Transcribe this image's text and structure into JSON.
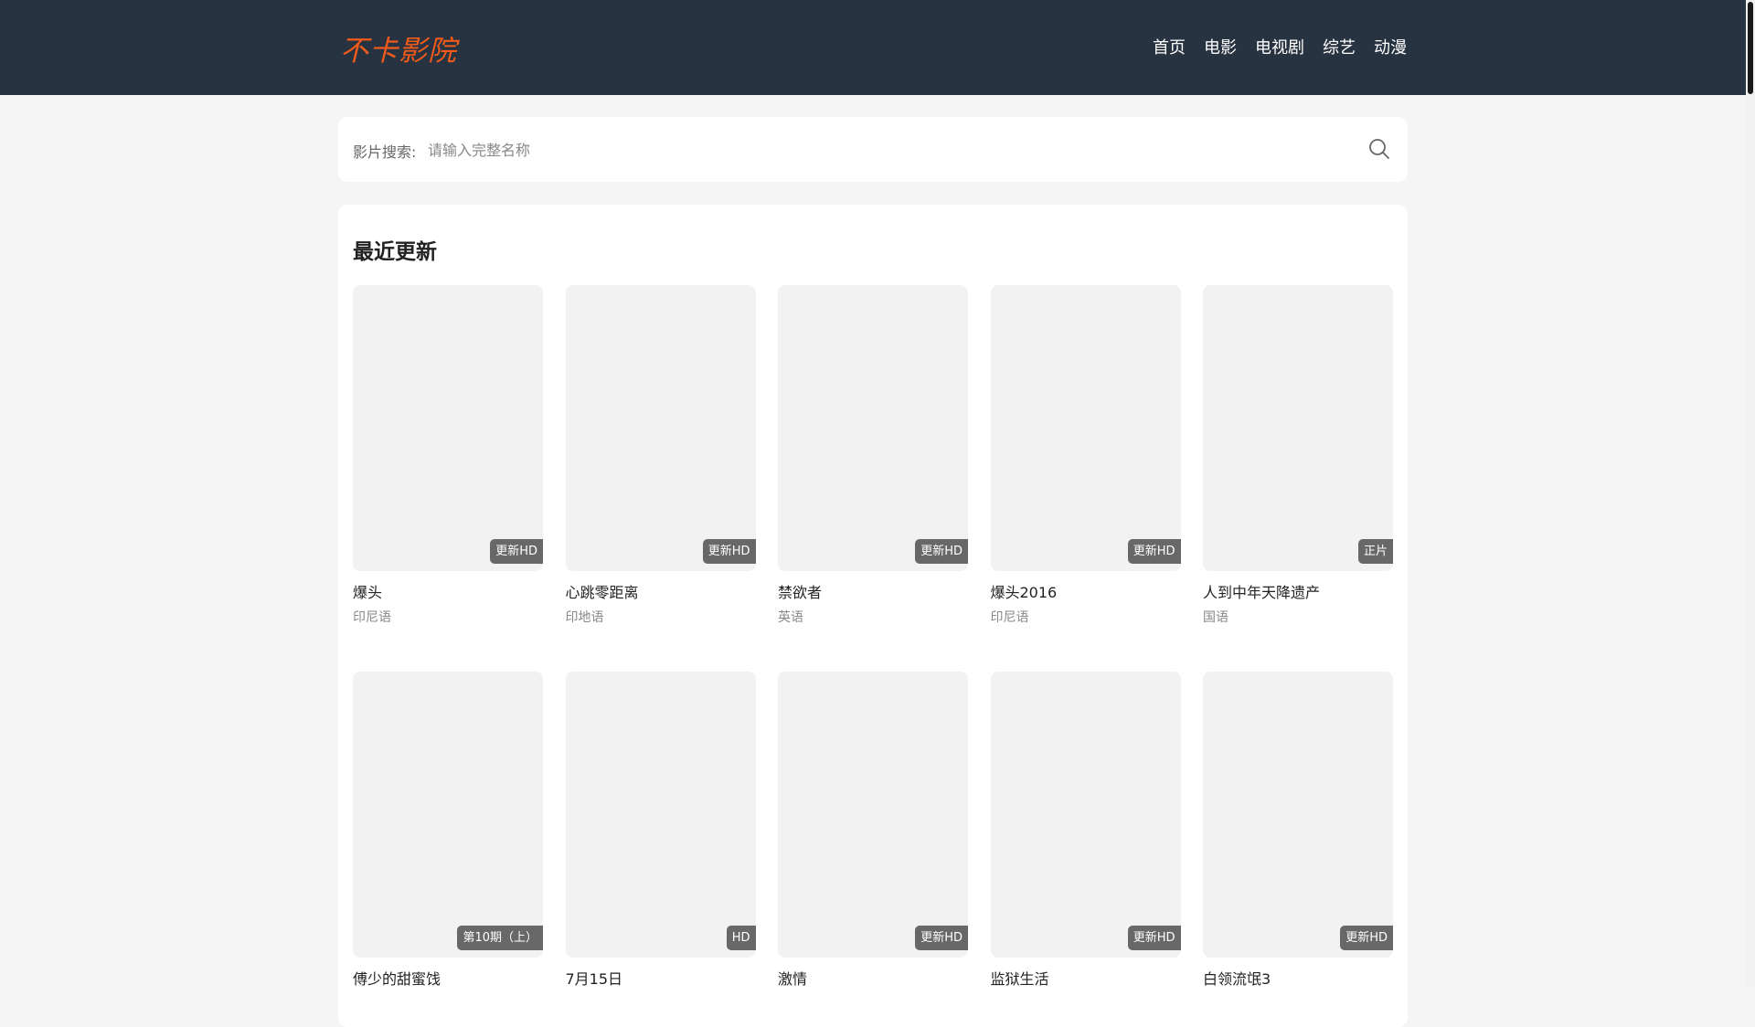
{
  "header": {
    "logo": "不卡影院",
    "nav": [
      "首页",
      "电影",
      "电视剧",
      "综艺",
      "动漫"
    ]
  },
  "search": {
    "label": "影片搜索:",
    "placeholder": "请输入完整名称"
  },
  "section": {
    "title": "最近更新"
  },
  "items": [
    {
      "title": "爆头",
      "lang": "印尼语",
      "badge": "更新HD"
    },
    {
      "title": "心跳零距离",
      "lang": "印地语",
      "badge": "更新HD"
    },
    {
      "title": "禁欲者",
      "lang": "英语",
      "badge": "更新HD"
    },
    {
      "title": "爆头2016",
      "lang": "印尼语",
      "badge": "更新HD"
    },
    {
      "title": "人到中年天降遗产",
      "lang": "国语",
      "badge": "正片"
    },
    {
      "title": "傅少的甜蜜饯",
      "lang": "",
      "badge": "第10期（上）"
    },
    {
      "title": "7月15日",
      "lang": "",
      "badge": "HD"
    },
    {
      "title": "激情",
      "lang": "",
      "badge": "更新HD"
    },
    {
      "title": "监狱生活",
      "lang": "",
      "badge": "更新HD"
    },
    {
      "title": "白领流氓3",
      "lang": "",
      "badge": "更新HD"
    }
  ]
}
